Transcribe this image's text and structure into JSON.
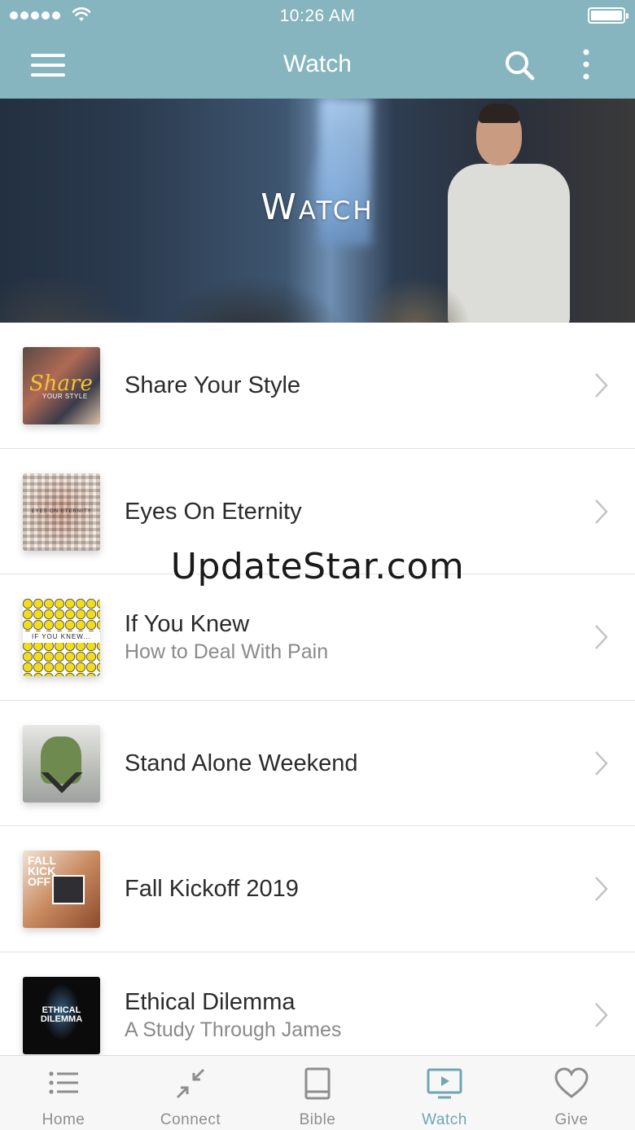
{
  "status_bar": {
    "time": "10:26 AM"
  },
  "nav": {
    "title": "Watch"
  },
  "hero": {
    "title": "Watch"
  },
  "watermark": "UpdateStar.com",
  "items": [
    {
      "title": "Share Your Style",
      "subtitle": "",
      "thumb_text": "Share",
      "thumb_text2": "YOUR STYLE"
    },
    {
      "title": "Eyes On Eternity",
      "subtitle": "",
      "thumb_text": "EYES ON ETERNITY"
    },
    {
      "title": "If You Knew",
      "subtitle": "How to Deal With Pain",
      "thumb_text": "IF YOU KNEW..."
    },
    {
      "title": "Stand Alone Weekend",
      "subtitle": ""
    },
    {
      "title": "Fall Kickoff 2019",
      "subtitle": "",
      "thumb_text": "FALL KICK OFF"
    },
    {
      "title": "Ethical Dilemma",
      "subtitle": "A Study Through James",
      "thumb_text": "ETHICAL DILEMMA"
    }
  ],
  "tabs": [
    {
      "label": "Home",
      "icon": "list-icon",
      "active": false
    },
    {
      "label": "Connect",
      "icon": "compress-arrows-icon",
      "active": false
    },
    {
      "label": "Bible",
      "icon": "book-icon",
      "active": false
    },
    {
      "label": "Watch",
      "icon": "tv-play-icon",
      "active": true
    },
    {
      "label": "Give",
      "icon": "heart-icon",
      "active": false
    }
  ],
  "colors": {
    "header": "#86b5bf",
    "tab_active": "#6fa6b3",
    "tab_inactive": "#8e8e8e"
  }
}
